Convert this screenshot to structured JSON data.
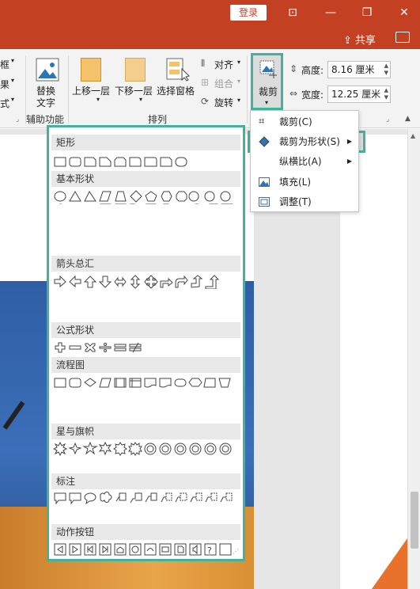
{
  "titlebar": {
    "login_label": "登录"
  },
  "tabs": {
    "share_label": "共享"
  },
  "ribbon": {
    "left_partial": [
      "框",
      "果",
      "式"
    ],
    "accessibility": {
      "alt_text_label_line1": "替换",
      "alt_text_label_line2": "文字",
      "group_label": "辅助功能"
    },
    "arrange": {
      "bring_forward": "上移一层",
      "send_backward": "下移一层",
      "selection_pane": "选择窗格",
      "align": "对齐",
      "group": "组合",
      "rotate": "旋转",
      "group_label": "排列"
    },
    "size": {
      "crop_label": "裁剪",
      "height_label": "高度:",
      "height_value": "8.16 厘米",
      "width_label": "宽度:",
      "width_value": "12.25 厘米"
    }
  },
  "crop_menu": {
    "items": [
      {
        "label": "裁剪(C)",
        "icon": "crop-icon"
      },
      {
        "label": "裁剪为形状(S)",
        "icon": "crop-to-shape-icon"
      },
      {
        "label": "纵横比(A)",
        "icon": ""
      },
      {
        "label": "填充(L)",
        "icon": "fill-icon"
      },
      {
        "label": "调整(T)",
        "icon": "fit-icon"
      }
    ]
  },
  "gallery": {
    "categories": [
      {
        "label": "矩形"
      },
      {
        "label": "基本形状"
      },
      {
        "label": "箭头总汇"
      },
      {
        "label": "公式形状"
      },
      {
        "label": "流程图"
      },
      {
        "label": "星与旗帜"
      },
      {
        "label": "标注"
      },
      {
        "label": "动作按钮"
      }
    ]
  },
  "colors": {
    "accent": "#c44023",
    "highlight": "#3fb39c"
  }
}
